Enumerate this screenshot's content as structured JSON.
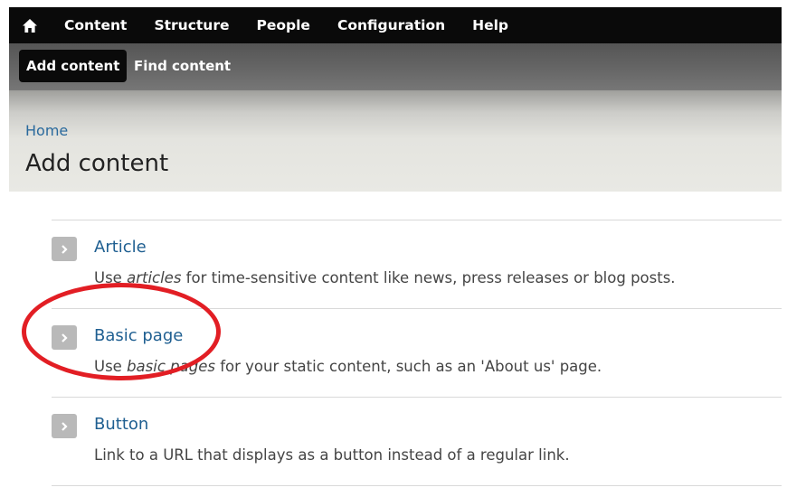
{
  "toolbar": {
    "menu": [
      "Content",
      "Structure",
      "People",
      "Configuration",
      "Help"
    ]
  },
  "tray": {
    "active_label": "Add content",
    "other_label": "Find content"
  },
  "header": {
    "breadcrumb": "Home",
    "title": "Add content"
  },
  "items": [
    {
      "title": "Article",
      "desc_before": "Use ",
      "desc_em": "articles",
      "desc_after": " for time-sensitive content like news, press releases or blog posts."
    },
    {
      "title": "Basic page",
      "desc_before": "Use ",
      "desc_em": "basic pages",
      "desc_after": " for your static content, such as an 'About us' page."
    },
    {
      "title": "Button",
      "desc_before": "",
      "desc_em": "",
      "desc_after": "Link to a URL that displays as a button instead of a regular link."
    }
  ],
  "icons": {
    "home": "home-icon",
    "item_arrow": "chevron-right-icon"
  },
  "colors": {
    "highlight": "#e21e24",
    "link": "#1f5f91",
    "toolbar": "#0a0a0a"
  }
}
